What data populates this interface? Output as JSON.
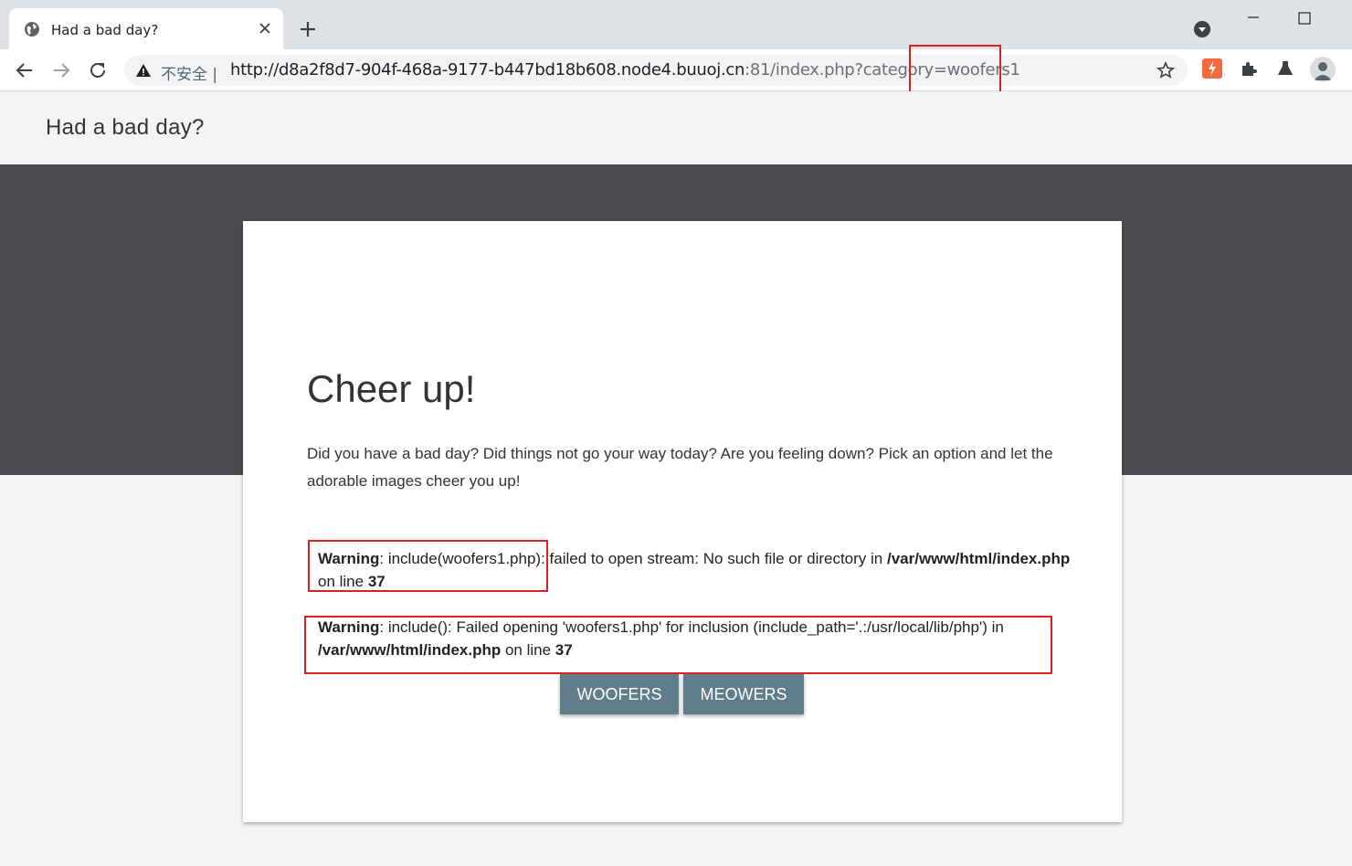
{
  "browser": {
    "tab_title": "Had a bad day?",
    "security_label": "不安全",
    "url_host": "http://d8a2f8d7-904f-468a-9177-b447bd18b608.node4.buuoj.cn",
    "url_rest": ":81/index.php?category=woofers1",
    "icons": [
      "globe-icon",
      "close-icon",
      "plus-icon",
      "tab-search-icon",
      "minimize-icon",
      "maximize-icon",
      "back-icon",
      "forward-icon",
      "reload-icon",
      "warning-icon",
      "star-icon",
      "extension-icon",
      "puzzle-icon",
      "flask-icon",
      "profile-icon"
    ]
  },
  "site": {
    "title": "Had a bad day?"
  },
  "card": {
    "heading": "Cheer up!",
    "text": "Did you have a bad day? Did things not go your way today? Are you feeling down? Pick an option and let the adorable images cheer you up!"
  },
  "warnings": [
    {
      "label": "Warning",
      "message": ": include(woofers1.php): failed to open stream: No such file or directory in ",
      "file": "/var/www/html/index.php",
      "on_line": " on line ",
      "line": "37"
    },
    {
      "label": "Warning",
      "message": ": include(): Failed opening 'woofers1.php' for inclusion (include_path='.:/usr/local/lib/php') in ",
      "file": "/var/www/html/index.php",
      "on_line": " on line ",
      "line": "37"
    }
  ],
  "buttons": {
    "woofers": "WOOFERS",
    "meowers": "MEOWERS"
  },
  "colors": {
    "hero": "#4a4b50",
    "button": "#607d8b",
    "highlight": "#e02020",
    "extension_accent": "#f36b3c"
  }
}
